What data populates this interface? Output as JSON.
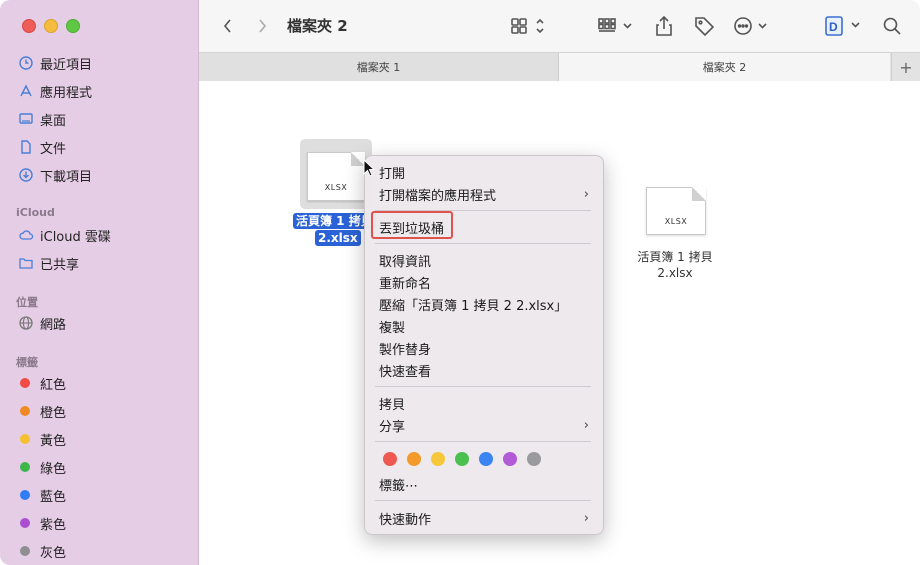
{
  "window": {
    "title": "檔案夾 2"
  },
  "sidebar": {
    "favorites": [
      {
        "label": "最近項目",
        "icon": "clock-icon"
      },
      {
        "label": "應用程式",
        "icon": "apps-icon"
      },
      {
        "label": "桌面",
        "icon": "desktop-icon"
      },
      {
        "label": "文件",
        "icon": "document-icon"
      },
      {
        "label": "下載項目",
        "icon": "download-icon"
      }
    ],
    "icloud_header": "iCloud",
    "icloud": [
      {
        "label": "iCloud 雲碟",
        "icon": "cloud-icon"
      },
      {
        "label": "已共享",
        "icon": "shared-folder-icon"
      }
    ],
    "locations_header": "位置",
    "locations": [
      {
        "label": "網路",
        "icon": "globe-icon"
      }
    ],
    "tags_header": "標籤",
    "tags": [
      {
        "label": "紅色",
        "color": "#f24a44"
      },
      {
        "label": "橙色",
        "color": "#f08a24"
      },
      {
        "label": "黃色",
        "color": "#f5c02f"
      },
      {
        "label": "綠色",
        "color": "#3cb649"
      },
      {
        "label": "藍色",
        "color": "#2f7ef5"
      },
      {
        "label": "紫色",
        "color": "#a94fcf"
      },
      {
        "label": "灰色",
        "color": "#8e8e93"
      }
    ]
  },
  "tabs": [
    {
      "label": "檔案夾 1"
    },
    {
      "label": "檔案夾 2"
    }
  ],
  "files": [
    {
      "ext": "XLSX",
      "name_line1": "活頁簿 1 拷貝",
      "name_line2": "2.xlsx",
      "selected": true
    },
    {
      "ext": "XLSX",
      "name_line1": "活頁簿 1 拷貝",
      "name_line2": "2.xlsx",
      "selected": false
    }
  ],
  "context_menu": {
    "items": {
      "open": "打開",
      "open_with": "打開檔案的應用程式",
      "trash": "丟到垃圾桶",
      "info": "取得資訊",
      "rename": "重新命名",
      "compress": "壓縮「活頁簿 1 拷貝 2 2.xlsx」",
      "duplicate": "複製",
      "alias": "製作替身",
      "quicklook": "快速查看",
      "copy": "拷貝",
      "share": "分享",
      "tags": "標籤⋯",
      "quick_actions": "快速動作"
    },
    "tag_colors": [
      "#ee5a52",
      "#f39a2b",
      "#f6c73a",
      "#4cc04f",
      "#3a85f2",
      "#b25bd6",
      "#9a9a9e"
    ]
  }
}
